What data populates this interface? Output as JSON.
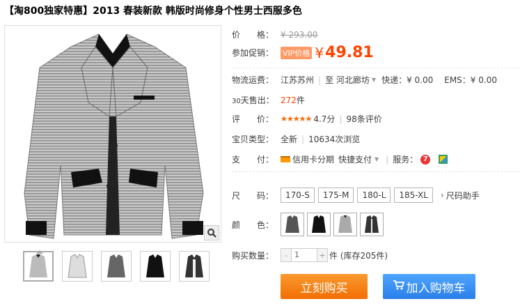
{
  "title": "【淘800独家特惠】2013 春装新款 韩版时尚修身个性男士西服多色",
  "price": {
    "label": "价　　格：",
    "original": "¥ 293.00"
  },
  "promo": {
    "label": "参加促销：",
    "badge": "VIP价格",
    "currency": "¥",
    "value": "49.81"
  },
  "shipping": {
    "label": "物流运费：",
    "from": "江苏苏州",
    "to_prefix": "至",
    "to": "河北廊坊",
    "express": "快递：¥ 0.00",
    "ems": "EMS：¥ 0.00"
  },
  "sales": {
    "label_prefix": "30",
    "label": "天售出：",
    "count": "272",
    "unit": "件"
  },
  "rating": {
    "label": "评　　价：",
    "stars": "★★★★★",
    "score": "4.7分",
    "reviews": "98条评价"
  },
  "item_type": {
    "label": "宝贝类型：",
    "condition": "全新",
    "views": "10634次浏览"
  },
  "payment": {
    "label": "支　　付：",
    "credit": "信用卡分期",
    "quick": "快捷支付",
    "service_label": "服务："
  },
  "size": {
    "label": "尺　　码：",
    "options": [
      "170-S",
      "175-M",
      "180-L",
      "185-XL"
    ],
    "helper": "尺码助手"
  },
  "color": {
    "label": "颜　　色："
  },
  "quantity": {
    "label": "购买数量：",
    "minus": "-",
    "value": "1",
    "plus": "+",
    "stock": "件 (库存205件)"
  },
  "buttons": {
    "buy": "立刻购买",
    "cart": "加入购物车"
  },
  "colors": {
    "accent": "#ff4400",
    "buy": "#f47b0b",
    "cart": "#3d8ff5"
  }
}
